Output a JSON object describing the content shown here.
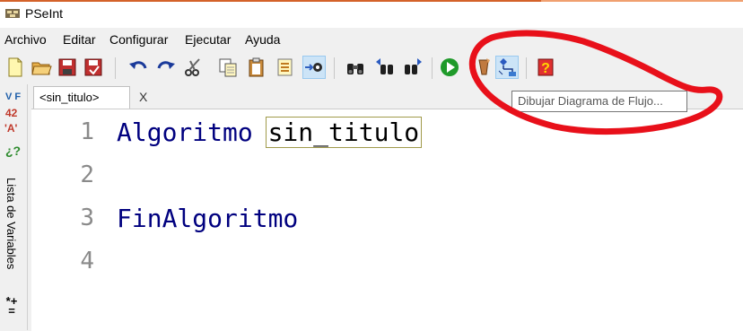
{
  "window": {
    "title": "PSeInt"
  },
  "menu": {
    "items": [
      "Archivo",
      "Editar",
      "Configurar",
      "Ejecutar",
      "Ayuda"
    ]
  },
  "toolbar": {
    "buttons": [
      "new-file-icon",
      "open-file-icon",
      "save-icon",
      "save-as-icon",
      "undo-icon",
      "redo-icon",
      "cut-icon",
      "copy-icon",
      "paste-icon",
      "move-lines-icon",
      "indent-icon",
      "search-icon",
      "search-previous-icon",
      "search-next-icon",
      "run-icon",
      "step-by-step-icon",
      "flowchart-icon",
      "help-icon"
    ],
    "tooltip": "Dibujar Diagrama de Flujo..."
  },
  "side_panel": {
    "label": "Lista de Variables",
    "glyphs": {
      "vf": "V F",
      "num": "42",
      "str": "'A'",
      "q": "¿?",
      "ops": "*+="
    },
    "colors": {
      "vf": "#1f5faa",
      "num": "#c0392b",
      "str": "#c0392b",
      "q": "#2e8b2e"
    }
  },
  "tabs": [
    {
      "label": "<sin_titulo>",
      "close": "X"
    }
  ],
  "editor": {
    "line_numbers": [
      "1",
      "2",
      "3",
      "4"
    ],
    "lines": [
      {
        "keyword": "Algoritmo",
        "identifier": "sin_titulo"
      },
      {
        "keyword": "",
        "identifier": ""
      },
      {
        "keyword": "FinAlgoritmo",
        "identifier": ""
      },
      {
        "keyword": "",
        "identifier": ""
      }
    ]
  },
  "annotation": {
    "color": "#e8101a"
  }
}
